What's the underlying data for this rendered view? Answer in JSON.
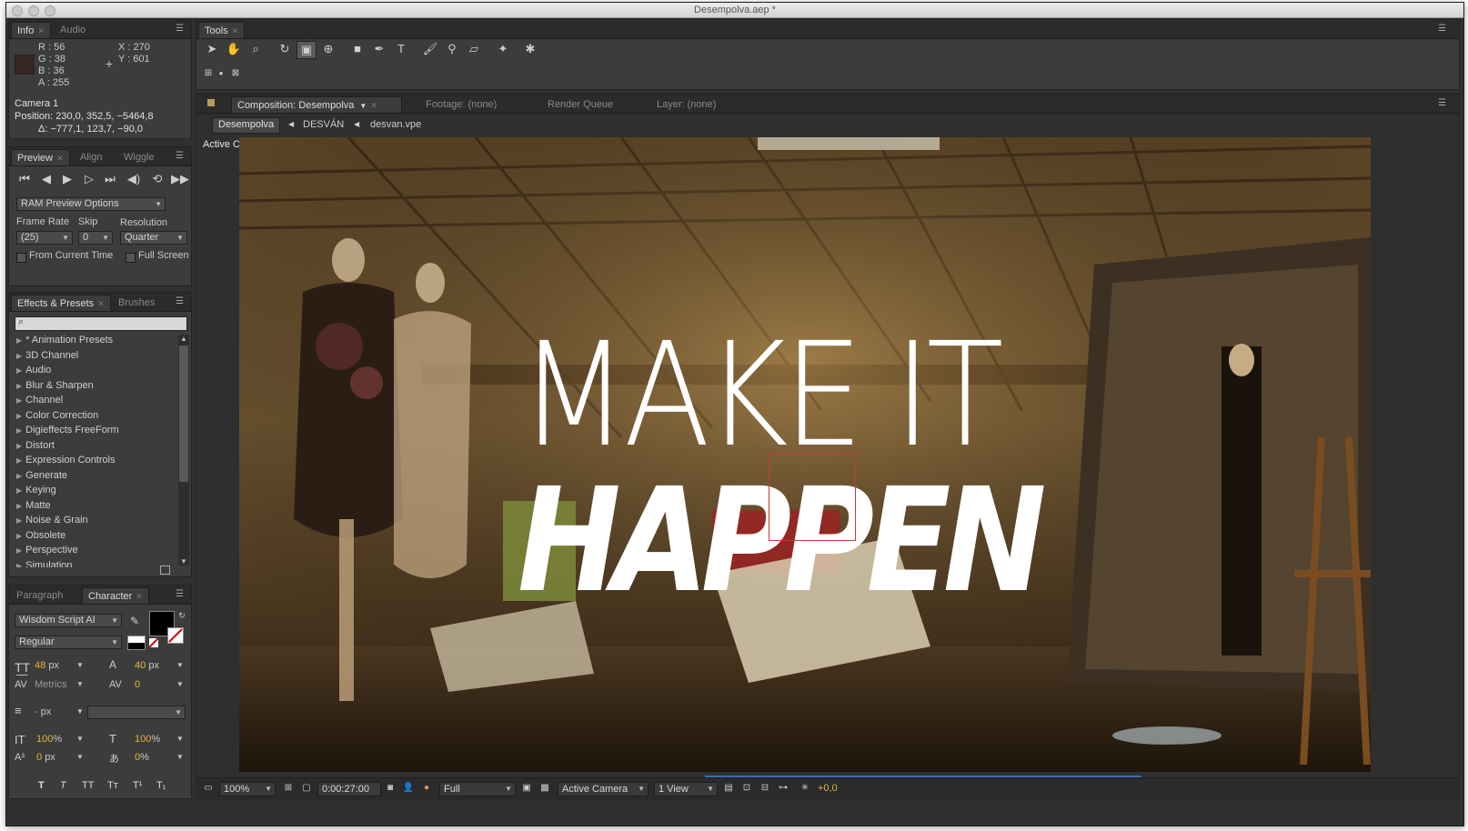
{
  "window": {
    "title": "Desempolva.aep *"
  },
  "info_panel": {
    "tabs": [
      "Info",
      "Audio"
    ],
    "r": "R : 56",
    "g": "G : 38",
    "b": "B : 36",
    "a": "A : 255",
    "x": "X : 270",
    "y": "Y : 601",
    "swatch": "#382624",
    "layer": "Camera 1",
    "position": "Position: 230,0, 352,5, −5464,8",
    "delta": "Δ: −777,1, 123,7, −90,0"
  },
  "preview_panel": {
    "tabs": [
      "Preview",
      "Align",
      "Wiggle"
    ],
    "ram_options": "RAM Preview Options",
    "frame_rate_label": "Frame Rate",
    "skip_label": "Skip",
    "resolution_label": "Resolution",
    "frame_rate": "(25)",
    "skip": "0",
    "resolution": "Quarter",
    "from_current": "From Current Time",
    "full_screen": "Full Screen"
  },
  "effects_panel": {
    "tabs": [
      "Effects & Presets",
      "Brushes"
    ],
    "items": [
      "* Animation Presets",
      "3D Channel",
      "Audio",
      "Blur & Sharpen",
      "Channel",
      "Color Correction",
      "Digieffects FreeForm",
      "Distort",
      "Expression Controls",
      "Generate",
      "Keying",
      "Matte",
      "Noise & Grain",
      "Obsolete",
      "Perspective",
      "Simulation"
    ]
  },
  "character_panel": {
    "tabs": [
      "Paragraph",
      "Character"
    ],
    "font": "Wisdom Script AI",
    "style": "Regular",
    "size": "48",
    "size_unit": "px",
    "leading": "40",
    "leading_unit": "px",
    "kerning": "Metrics",
    "tracking": "0",
    "stroke_width": "-",
    "stroke_unit": "px",
    "vscale": "100",
    "hscale": "100",
    "pct": "%",
    "baseline": "0",
    "baseline_unit": "px",
    "tsume": "0",
    "tsume_unit": "%",
    "styles": [
      "T",
      "T",
      "TT",
      "Tт",
      "T¹",
      "T₁"
    ]
  },
  "tools_panel": {
    "title": "Tools"
  },
  "composition": {
    "tabs": [
      "Composition: Desempolva",
      "Footage: (none)",
      "Render Queue",
      "Layer: (none)"
    ],
    "breadcrumbs": [
      "Desempolva",
      "DESVÁN",
      "desvan.vpe"
    ],
    "active_camera_label": "Active Camera",
    "headline_top": "MAKE IT",
    "headline_bottom": "HAPPEN"
  },
  "status_bar": {
    "zoom": "100%",
    "timecode": "0:00:27:00",
    "resolution": "Full",
    "view": "Active Camera",
    "views": "1 View",
    "exposure": "+0,0"
  },
  "colors": {
    "accent": "#e6b43c",
    "panel": "#3c3c3c",
    "tabbar": "#2b2b2b"
  }
}
